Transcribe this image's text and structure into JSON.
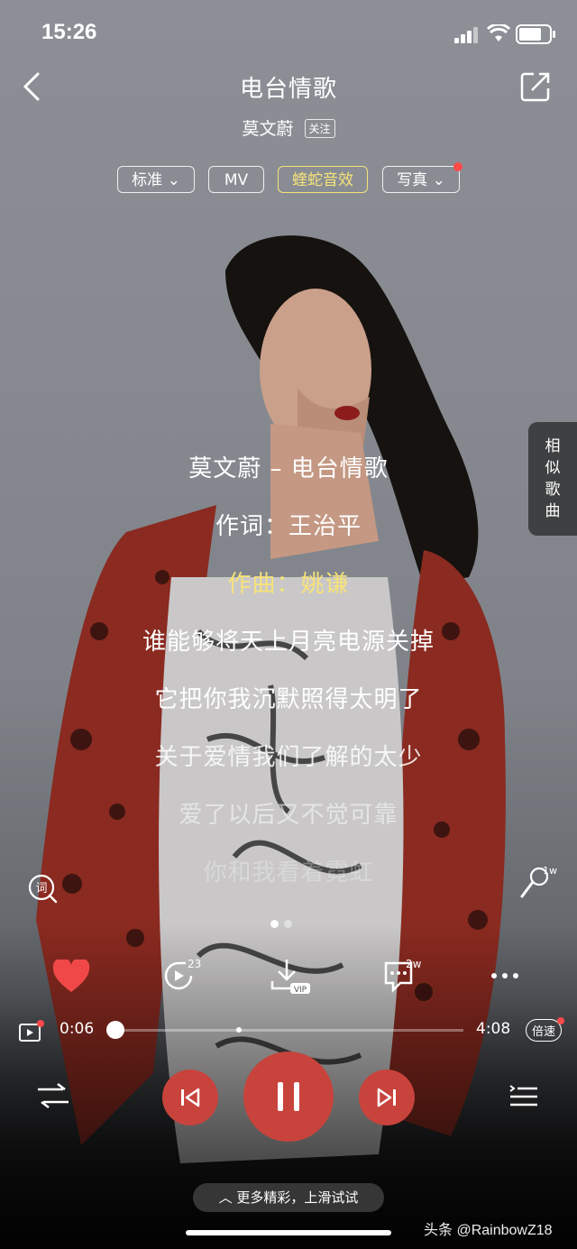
{
  "status_bar": {
    "time": "15:26"
  },
  "header": {
    "title": "电台情歌",
    "artist": "莫文蔚",
    "follow_label": "关注"
  },
  "chips": [
    {
      "label": "标准",
      "has_dropdown": true
    },
    {
      "label": "MV"
    },
    {
      "label": "蝰蛇音效",
      "highlight": true
    },
    {
      "label": "写真",
      "has_dropdown": true,
      "dot": true
    }
  ],
  "side_panel": {
    "label_chars": [
      "相",
      "似",
      "歌",
      "曲"
    ]
  },
  "lyrics": [
    "莫文蔚 – 电台情歌",
    "作词：王治平",
    "作曲：姚谦",
    "谁能够将天上月亮电源关掉",
    "它把你我沉默照得太明了",
    "关于爱情我们了解的太少",
    "爱了以后又不觉可靠",
    "你和我看着霓虹"
  ],
  "active_lyric_index": 2,
  "lyric_icon_label": "词",
  "mic_badge": "1w",
  "actions": {
    "repeat_count": "23",
    "vip_label": "VIP",
    "comment_count": "2w"
  },
  "progress": {
    "current": "0:06",
    "total": "4:08",
    "played_fraction": 0.024,
    "marker_fraction": 0.37,
    "speed_label": "倍速"
  },
  "hint": "更多精彩，上滑试试",
  "watermark": "头条 @RainbowZ18",
  "colors": {
    "accent_red": "#c8433c",
    "lyric_highlight": "#f7e37a",
    "like_red": "#f04848"
  }
}
